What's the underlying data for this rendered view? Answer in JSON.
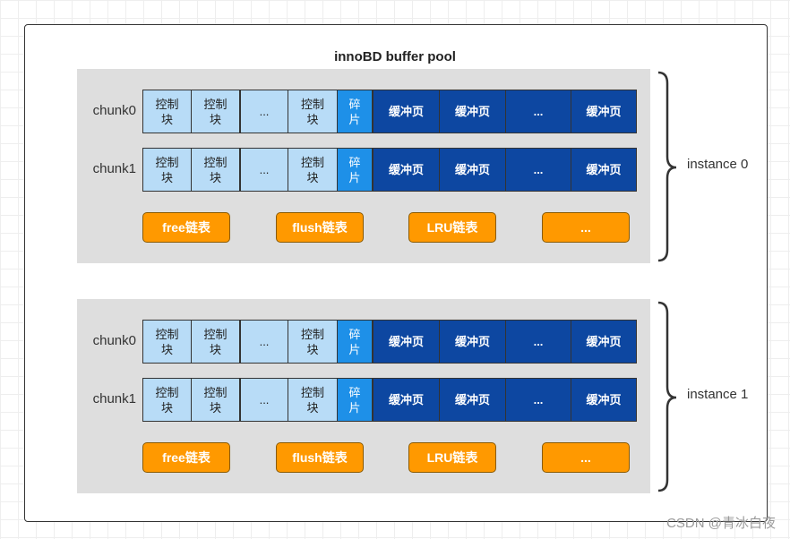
{
  "title": "innoBD buffer pool",
  "instances": [
    {
      "label": "instance 0",
      "chunks": [
        {
          "label": "chunk0",
          "ctrl": [
            "控制块",
            "控制块",
            "...",
            "控制块"
          ],
          "frag": "碎片",
          "pages": [
            "缓冲页",
            "缓冲页",
            "...",
            "缓冲页"
          ]
        },
        {
          "label": "chunk1",
          "ctrl": [
            "控制块",
            "控制块",
            "...",
            "控制块"
          ],
          "frag": "碎片",
          "pages": [
            "缓冲页",
            "缓冲页",
            "...",
            "缓冲页"
          ]
        }
      ],
      "lists": [
        "free链表",
        "flush链表",
        "LRU链表",
        "..."
      ]
    },
    {
      "label": "instance 1",
      "chunks": [
        {
          "label": "chunk0",
          "ctrl": [
            "控制块",
            "控制块",
            "...",
            "控制块"
          ],
          "frag": "碎片",
          "pages": [
            "缓冲页",
            "缓冲页",
            "...",
            "缓冲页"
          ]
        },
        {
          "label": "chunk1",
          "ctrl": [
            "控制块",
            "控制块",
            "...",
            "控制块"
          ],
          "frag": "碎片",
          "pages": [
            "缓冲页",
            "缓冲页",
            "...",
            "缓冲页"
          ]
        }
      ],
      "lists": [
        "free链表",
        "flush链表",
        "LRU链表",
        "..."
      ]
    }
  ],
  "watermark": "CSDN @青冰白夜",
  "colors": {
    "instance_bg": "#dedede",
    "control_block": "#b8dcf7",
    "fragment": "#1e90e8",
    "buffer_page": "#0d47a1",
    "list": "#ff9900"
  }
}
